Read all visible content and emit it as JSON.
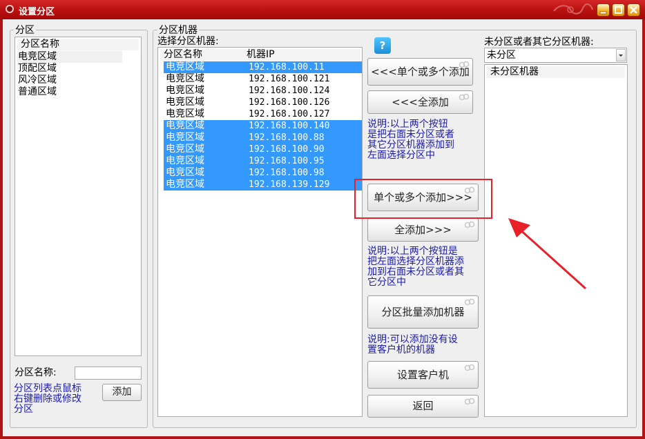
{
  "window": {
    "title": "设置分区"
  },
  "partitions": {
    "group_label": "分区",
    "column_header": "分区名称",
    "items": [
      "电竞区域",
      "顶配区域",
      "风冷区域",
      "普通区域"
    ],
    "name_label": "分区名称:",
    "name_value": "",
    "add_button": "添加",
    "hint": [
      "分区列表点鼠标",
      "右键删除或修改",
      "分区"
    ]
  },
  "machines": {
    "group_label": "分区机器",
    "sub_label": "选择分区机器:",
    "columns": [
      "分区名称",
      "机器IP"
    ],
    "rows": [
      {
        "name": "电竞区域",
        "ip": "192.168.100.11",
        "selected": true
      },
      {
        "name": "电竞区域",
        "ip": "192.168.100.121",
        "selected": false
      },
      {
        "name": "电竞区域",
        "ip": "192.168.100.124",
        "selected": false
      },
      {
        "name": "电竞区域",
        "ip": "192.168.100.126",
        "selected": false
      },
      {
        "name": "电竞区域",
        "ip": "192.168.100.127",
        "selected": false
      },
      {
        "name": "电竞区域",
        "ip": "192.168.100.140",
        "selected": true
      },
      {
        "name": "电竞区域",
        "ip": "192.168.100.88",
        "selected": true
      },
      {
        "name": "电竞区域",
        "ip": "192.168.100.90",
        "selected": true
      },
      {
        "name": "电竞区域",
        "ip": "192.168.100.95",
        "selected": true
      },
      {
        "name": "电竞区域",
        "ip": "192.168.100.98",
        "selected": true
      },
      {
        "name": "电竞区域",
        "ip": "192.168.139.129",
        "selected": true
      }
    ]
  },
  "actions": {
    "help": "?",
    "add_left_some": "<<<单个或多个添加",
    "add_left_all": "<<<全添加",
    "note1": [
      "说明:以上两个按钮",
      "是把右面未分区或者",
      "其它分区机器添加到",
      "左面选择分区中"
    ],
    "add_right_some": "单个或多个添加>>>",
    "add_right_all": "全添加>>>",
    "note2": [
      "说明:以上两个按钮是",
      "把左面选择分区机器添",
      "加到右面未分区或者其",
      "它分区中"
    ],
    "batch_add": "分区批量添加机器",
    "note3": [
      "说明:可以添加没有设",
      "置客户机的机器"
    ],
    "set_client": "设置客户机",
    "back": "返回"
  },
  "unassigned": {
    "label": "未分区或者其它分区机器:",
    "select_value": "未分区",
    "list_header": "未分区机器"
  },
  "colors": {
    "title_bar": "#b81010",
    "selection": "#3399ff",
    "note_text": "#1a1ab0",
    "highlight": "#e8202a"
  }
}
